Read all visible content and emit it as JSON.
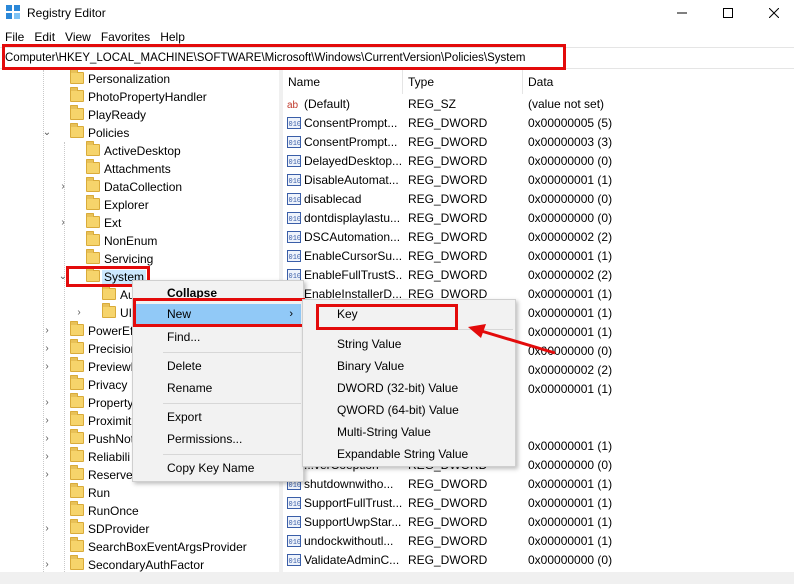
{
  "window": {
    "title": "Registry Editor",
    "controls": {
      "minimize": "—",
      "maximize": "☐",
      "close": "✕"
    }
  },
  "menubar": [
    "File",
    "Edit",
    "View",
    "Favorites",
    "Help"
  ],
  "address": "Computer\\HKEY_LOCAL_MACHINE\\SOFTWARE\\Microsoft\\Windows\\CurrentVersion\\Policies\\System",
  "tree": {
    "items": [
      {
        "label": "Personalization",
        "arrow": ""
      },
      {
        "label": "PhotoPropertyHandler",
        "arrow": ""
      },
      {
        "label": "PlayReady",
        "arrow": ""
      },
      {
        "label": "Policies",
        "arrow": "⌄"
      },
      {
        "label": "ActiveDesktop",
        "arrow": ""
      },
      {
        "label": "Attachments",
        "arrow": ""
      },
      {
        "label": "DataCollection",
        "arrow": "›"
      },
      {
        "label": "Explorer",
        "arrow": ""
      },
      {
        "label": "Ext",
        "arrow": "›"
      },
      {
        "label": "NonEnum",
        "arrow": ""
      },
      {
        "label": "Servicing",
        "arrow": ""
      },
      {
        "label": "System",
        "arrow": "⌄"
      },
      {
        "label": "Au",
        "arrow": ""
      },
      {
        "label": "UI",
        "arrow": "›"
      },
      {
        "label": "PowerEf",
        "arrow": "›"
      },
      {
        "label": "Precision",
        "arrow": "›"
      },
      {
        "label": "PreviewH",
        "arrow": "›"
      },
      {
        "label": "Privacy",
        "arrow": ""
      },
      {
        "label": "Property",
        "arrow": "›"
      },
      {
        "label": "Proximit",
        "arrow": "›"
      },
      {
        "label": "PushNot",
        "arrow": "›"
      },
      {
        "label": "Reliabili",
        "arrow": "›"
      },
      {
        "label": "ReserveM",
        "arrow": "›"
      },
      {
        "label": "Run",
        "arrow": ""
      },
      {
        "label": "RunOnce",
        "arrow": ""
      },
      {
        "label": "SDProvider",
        "arrow": "›"
      },
      {
        "label": "SearchBoxEventArgsProvider",
        "arrow": ""
      },
      {
        "label": "SecondaryAuthFactor",
        "arrow": "›"
      }
    ]
  },
  "columns": {
    "name": "Name",
    "type": "Type",
    "data": "Data"
  },
  "values": [
    {
      "name": "(Default)",
      "type": "REG_SZ",
      "data": "(value not set)",
      "icon": "string-value-icon"
    },
    {
      "name": "ConsentPrompt...",
      "type": "REG_DWORD",
      "data": "0x00000005 (5)",
      "icon": "dword-value-icon"
    },
    {
      "name": "ConsentPrompt...",
      "type": "REG_DWORD",
      "data": "0x00000003 (3)",
      "icon": "dword-value-icon"
    },
    {
      "name": "DelayedDesktop...",
      "type": "REG_DWORD",
      "data": "0x00000000 (0)",
      "icon": "dword-value-icon"
    },
    {
      "name": "DisableAutomat...",
      "type": "REG_DWORD",
      "data": "0x00000001 (1)",
      "icon": "dword-value-icon"
    },
    {
      "name": "disablecad",
      "type": "REG_DWORD",
      "data": "0x00000000 (0)",
      "icon": "dword-value-icon"
    },
    {
      "name": "dontdisplaylastu...",
      "type": "REG_DWORD",
      "data": "0x00000000 (0)",
      "icon": "dword-value-icon"
    },
    {
      "name": "DSCAutomation...",
      "type": "REG_DWORD",
      "data": "0x00000002 (2)",
      "icon": "dword-value-icon"
    },
    {
      "name": "EnableCursorSu...",
      "type": "REG_DWORD",
      "data": "0x00000001 (1)",
      "icon": "dword-value-icon"
    },
    {
      "name": "EnableFullTrustS...",
      "type": "REG_DWORD",
      "data": "0x00000002 (2)",
      "icon": "dword-value-icon"
    },
    {
      "name": "EnableInstallerD...",
      "type": "REG_DWORD",
      "data": "0x00000001 (1)",
      "icon": "dword-value-icon"
    },
    {
      "name": "",
      "type": "",
      "data": "0x00000001 (1)",
      "icon": ""
    },
    {
      "name": "",
      "type": "",
      "data": "0x00000001 (1)",
      "icon": ""
    },
    {
      "name": "",
      "type": "",
      "data": "0x00000000 (0)",
      "icon": ""
    },
    {
      "name": "",
      "type": "",
      "data": "0x00000002 (2)",
      "icon": ""
    },
    {
      "name": "",
      "type": "",
      "data": "0x00000001 (1)",
      "icon": ""
    },
    {
      "name": "",
      "type": "",
      "data": "",
      "icon": ""
    },
    {
      "name": "",
      "type": "",
      "data": "",
      "icon": ""
    },
    {
      "name": "",
      "type": "",
      "data": "0x00000001 (1)",
      "icon": ""
    },
    {
      "name": "",
      "type": "",
      "data": "0x00000000 (0)",
      "icon": ""
    },
    {
      "name": "shutdownwitho...",
      "type": "REG_DWORD",
      "data": "0x00000001 (1)",
      "icon": "dword-value-icon"
    },
    {
      "name": "SupportFullTrust...",
      "type": "REG_DWORD",
      "data": "0x00000001 (1)",
      "icon": "dword-value-icon"
    },
    {
      "name": "SupportUwpStar...",
      "type": "REG_DWORD",
      "data": "0x00000001 (1)",
      "icon": "dword-value-icon"
    },
    {
      "name": "undockwithoutl...",
      "type": "REG_DWORD",
      "data": "0x00000001 (1)",
      "icon": "dword-value-icon"
    },
    {
      "name": "ValidateAdminC...",
      "type": "REG_DWORD",
      "data": "0x00000000 (0)",
      "icon": "dword-value-icon"
    }
  ],
  "context_menu": {
    "collapse": "Collapse",
    "new": "New",
    "find": "Find...",
    "delete": "Delete",
    "rename": "Rename",
    "export": "Export",
    "permissions": "Permissions...",
    "copy_key_name": "Copy Key Name",
    "submenu_arrow": "›"
  },
  "new_submenu": {
    "key": "Key",
    "string_value": "String Value",
    "binary_value": "Binary Value",
    "dword_value": "DWORD (32-bit) Value",
    "qword_value": "QWORD (64-bit) Value",
    "multi_string_value": "Multi-String Value",
    "expandable_string_value": "Expandable String Value"
  },
  "partial_values": {
    "row_a": "...verCoeption",
    "row_b": "REG_DWORD"
  },
  "colors": {
    "highlight": "#e30b0b",
    "selection": "#cce8ff",
    "menu_hover": "#91c9f7",
    "folder": "#f6d46b"
  }
}
